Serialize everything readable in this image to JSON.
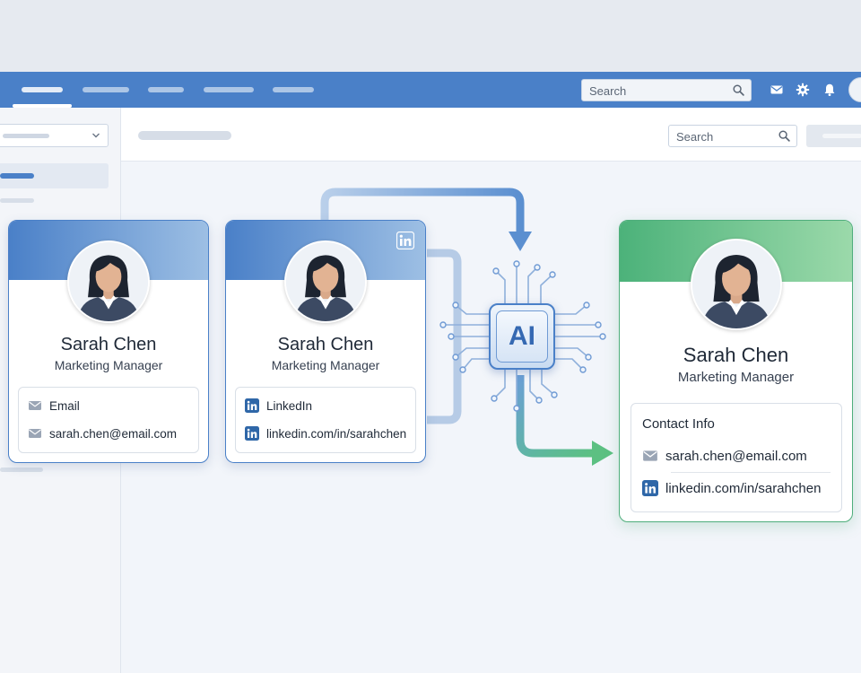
{
  "app": {
    "search_placeholder": "Search",
    "header_icons": [
      "mail-icon",
      "gear-icon",
      "bell-icon"
    ],
    "accent": "#4a80c8"
  },
  "toolbar": {
    "search_placeholder": "Search"
  },
  "cards": [
    {
      "name": "Sarah Chen",
      "role": "Marketing Manager",
      "rows": [
        {
          "icon": "mail-icon",
          "text": "Email"
        },
        {
          "icon": "mail-icon",
          "text": "sarah.chen@email.com"
        }
      ]
    },
    {
      "name": "Sarah Chen",
      "role": "Marketing Manager",
      "badge": "linkedin-icon",
      "rows": [
        {
          "icon": "linkedin-icon",
          "text": "LinkedIn"
        },
        {
          "icon": "linkedin-icon",
          "text": "linkedin.com/in/sarahchen"
        }
      ]
    }
  ],
  "merged_card": {
    "name": "Sarah Chen",
    "role": "Marketing Manager",
    "info_title": "Contact Info",
    "rows": [
      {
        "icon": "mail-icon",
        "text": "sarah.chen@email.com"
      },
      {
        "icon": "linkedin-icon",
        "text": "linkedin.com/in/sarahchen"
      }
    ],
    "accent": "#4fae7c"
  },
  "ai_chip": {
    "label": "AI"
  }
}
